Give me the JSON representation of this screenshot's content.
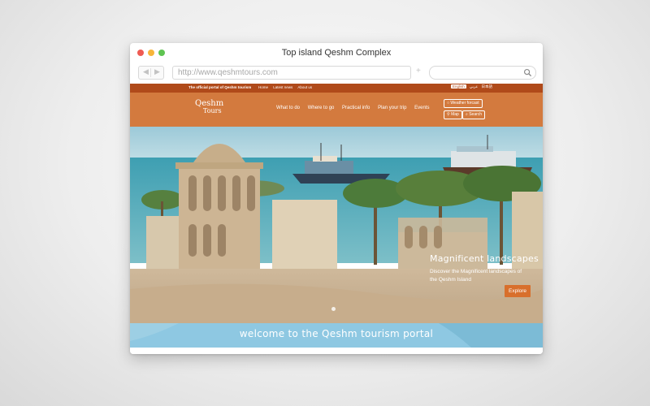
{
  "window": {
    "title": "Top island Qeshm Complex",
    "url": "http://www.qeshmtours.com"
  },
  "site": {
    "tagline": "The official portal of Qeshm tourism",
    "top_links": [
      "Home",
      "Latest news",
      "About us"
    ],
    "languages": [
      "English",
      "عربي",
      "日本語"
    ],
    "logo_line1": "Qeshm",
    "logo_line2": "Tours",
    "menu": [
      "What to do",
      "Where to go",
      "Practical info",
      "Plan your trip",
      "Events"
    ],
    "weather_button": "Weather forcast",
    "map_button": "Map",
    "search_button": "Search"
  },
  "hero": {
    "caption_title": "Magnificent landscapes",
    "caption_desc": "Discover the Magnificent landscapes of the Qeshm Island",
    "explore_button": "Explore"
  },
  "welcome": {
    "text": "welcome to the Qeshm tourism portal"
  },
  "colors": {
    "accent": "#d37a3e",
    "top_strip": "#b04a1a",
    "welcome_band": "#8ec8e2",
    "explore": "#d86f2c"
  },
  "icons": [
    "back-arrow-icon",
    "forward-arrow-icon",
    "plus-icon",
    "search-icon",
    "sun-icon",
    "map-pin-icon"
  ]
}
